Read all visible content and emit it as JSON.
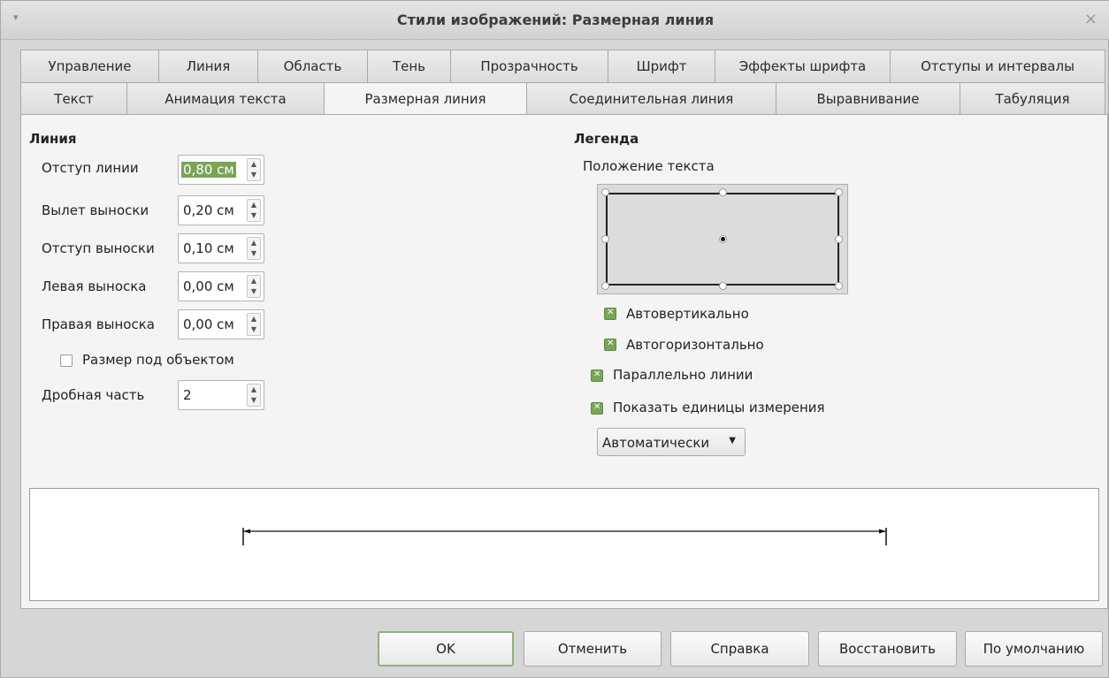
{
  "window": {
    "title": "Стили изображений: Размерная линия",
    "menu_glyph": "▾",
    "close_glyph": "×"
  },
  "tabs_row1": [
    "Управление",
    "Линия",
    "Область",
    "Тень",
    "Прозрачность",
    "Шрифт",
    "Эффекты шрифта",
    "Отступы и интервалы"
  ],
  "tabs_row2": [
    "Текст",
    "Анимация текста",
    "Размерная линия",
    "Соединительная линия",
    "Выравнивание",
    "Табуляция"
  ],
  "active_tab": "Размерная линия",
  "line_section": {
    "title": "Линия",
    "fields": [
      {
        "label": "Отступ линии",
        "value": "0,80 см"
      },
      {
        "label": "Вылет выноски",
        "value": "0,20 см"
      },
      {
        "label": "Отступ выноски",
        "value": "0,10 см"
      },
      {
        "label": "Левая выноска",
        "value": "0,00 см"
      },
      {
        "label": "Правая выноска",
        "value": "0,00 см"
      }
    ],
    "below_object": {
      "label": "Размер под объектом",
      "checked": false
    },
    "decimal_places": {
      "label": "Дробная часть",
      "value": "2"
    }
  },
  "legend_section": {
    "title": "Легенда",
    "text_position_label": "Положение текста",
    "auto_vertical": {
      "label": "Автовертикально",
      "checked": true
    },
    "auto_horizontal": {
      "label": "Автогоризонтально",
      "checked": true
    },
    "parallel_to_line": {
      "label": "Параллельно линии",
      "checked": true
    },
    "show_units": {
      "label": "Показать единицы измерения",
      "checked": true
    },
    "units_dropdown": "Автоматически"
  },
  "buttons": {
    "ok": "OK",
    "cancel": "Отменить",
    "help": "Справка",
    "reset": "Восстановить",
    "default": "По умолчанию"
  },
  "colors": {
    "accent": "#7aa456",
    "panel": "#f4f4f4",
    "background": "#d6d6d6"
  }
}
